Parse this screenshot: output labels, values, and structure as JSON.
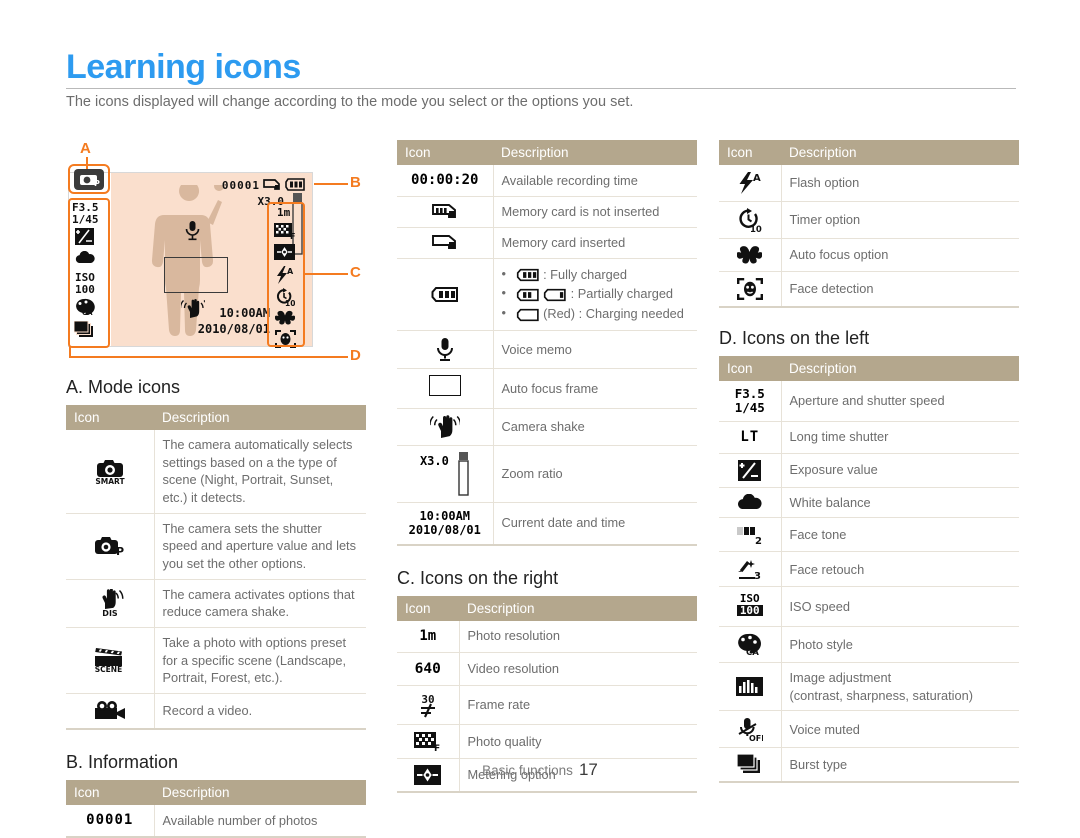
{
  "page": {
    "title": "Learning icons",
    "subtitle": "The icons displayed will change according to the mode you select or the options you set.",
    "footer_label": "Basic functions",
    "footer_page": "17",
    "accent_blue": "#2d9bf0",
    "callout_orange": "#f47b20",
    "table_header_tan": "#b4a78d",
    "lcd_background": "#fadfcd"
  },
  "lcd": {
    "callouts": [
      {
        "id": "A",
        "label": "A"
      },
      {
        "id": "B",
        "label": "B"
      },
      {
        "id": "C",
        "label": "C"
      },
      {
        "id": "D",
        "label": "D"
      }
    ],
    "top_bar": {
      "shots_remaining": "00001",
      "memory_card_icon": "memory-card-inserted-icon",
      "battery_icon": "battery-full-icon"
    },
    "zoom_ratio": "X3.0",
    "time": "10:00AM",
    "date": "2010/08/01",
    "mode_icon": "program-mode-icon",
    "left_icons": [
      {
        "name": "aperture-shutter-icon",
        "line1": "F3.5",
        "line2": "1/45"
      },
      {
        "name": "exposure-value-icon"
      },
      {
        "name": "white-balance-icon"
      },
      {
        "name": "iso-speed-icon",
        "line1": "ISO",
        "line2": "100"
      },
      {
        "name": "photo-style-icon",
        "label": "CA"
      },
      {
        "name": "burst-type-icon"
      }
    ],
    "right_icons": [
      {
        "name": "photo-resolution-icon",
        "label": "1m"
      },
      {
        "name": "photo-quality-icon",
        "label": "F"
      },
      {
        "name": "metering-option-icon"
      },
      {
        "name": "flash-option-icon",
        "label": "A"
      },
      {
        "name": "timer-option-icon",
        "label": "10"
      },
      {
        "name": "auto-focus-option-icon"
      },
      {
        "name": "face-detection-icon"
      }
    ],
    "center_icons": [
      {
        "name": "voice-memo-icon"
      },
      {
        "name": "auto-focus-frame-icon"
      },
      {
        "name": "camera-shake-icon"
      }
    ]
  },
  "tables": {
    "headers": {
      "icon": "Icon",
      "description": "Description"
    },
    "mode_icons": {
      "caption": "A. Mode icons",
      "rows": [
        {
          "icon_name": "smart-auto-mode-icon",
          "icon_text": "SMART",
          "description": "The camera automatically selects settings based on a the type of scene (Night, Portrait, Sunset, etc.) it detects."
        },
        {
          "icon_name": "program-mode-icon",
          "icon_text": "P",
          "description": "The camera sets the shutter speed and aperture value and lets you set the other options."
        },
        {
          "icon_name": "dis-mode-icon",
          "icon_text": "DIS",
          "description": "The camera activates options that reduce camera shake."
        },
        {
          "icon_name": "scene-mode-icon",
          "icon_text": "SCENE",
          "description": "Take a photo with options preset for a specific scene (Landscape, Portrait, Forest, etc.)."
        },
        {
          "icon_name": "movie-mode-icon",
          "icon_text": "",
          "description": "Record a video."
        }
      ]
    },
    "information": {
      "caption": "B. Information",
      "rows": [
        {
          "icon_name": "available-photos-icon",
          "icon_text": "00001",
          "description": "Available number of photos"
        }
      ]
    },
    "middle": {
      "rows": [
        {
          "icon_name": "recording-time-icon",
          "icon_text": "00:00:20",
          "description": "Available recording time"
        },
        {
          "icon_name": "memory-card-not-inserted-icon",
          "icon_text": "",
          "description": "Memory card is not inserted"
        },
        {
          "icon_name": "memory-card-inserted-icon",
          "icon_text": "",
          "description": "Memory card inserted"
        },
        {
          "icon_name": "battery-icon",
          "icon_text": "",
          "bullets": [
            ": Fully charged",
            ": Partially charged",
            "(Red) : Charging needed"
          ]
        },
        {
          "icon_name": "voice-memo-icon",
          "icon_text": "",
          "description": "Voice memo"
        },
        {
          "icon_name": "auto-focus-frame-icon",
          "icon_text": "",
          "description": "Auto focus frame"
        },
        {
          "icon_name": "camera-shake-icon",
          "icon_text": "",
          "description": "Camera shake"
        },
        {
          "icon_name": "zoom-ratio-icon",
          "icon_text": "X3.0",
          "description": "Zoom ratio"
        },
        {
          "icon_name": "date-time-icon",
          "icon_text": "10:00AM",
          "icon_text2": "2010/08/01",
          "description": "Current date and time"
        }
      ]
    },
    "icons_right": {
      "caption": "C. Icons on the right",
      "rows": [
        {
          "icon_name": "photo-resolution-icon",
          "icon_text": "1m",
          "description": "Photo resolution"
        },
        {
          "icon_name": "video-resolution-icon",
          "icon_text": "640",
          "description": "Video resolution"
        },
        {
          "icon_name": "frame-rate-icon",
          "icon_text": "30",
          "description": "Frame rate"
        },
        {
          "icon_name": "photo-quality-icon",
          "icon_text": "",
          "description": "Photo quality"
        },
        {
          "icon_name": "metering-option-icon",
          "icon_text": "",
          "description": "Metering option"
        }
      ]
    },
    "options": {
      "rows": [
        {
          "icon_name": "flash-option-icon",
          "icon_text": "A",
          "description": "Flash option"
        },
        {
          "icon_name": "timer-option-icon",
          "icon_text": "10",
          "description": "Timer option"
        },
        {
          "icon_name": "auto-focus-option-icon",
          "icon_text": "",
          "description": "Auto focus option"
        },
        {
          "icon_name": "face-detection-icon",
          "icon_text": "",
          "description": "Face detection"
        }
      ]
    },
    "icons_left": {
      "caption": "D. Icons on the left",
      "rows": [
        {
          "icon_name": "aperture-shutter-icon",
          "icon_text": "F3.5",
          "icon_text2": "1/45",
          "description": "Aperture and shutter speed"
        },
        {
          "icon_name": "long-time-shutter-icon",
          "icon_text": "LT",
          "description": "Long time shutter"
        },
        {
          "icon_name": "exposure-value-icon",
          "icon_text": "",
          "description": "Exposure value"
        },
        {
          "icon_name": "white-balance-icon",
          "icon_text": "",
          "description": "White balance"
        },
        {
          "icon_name": "face-tone-icon",
          "icon_text": "2",
          "description": "Face tone"
        },
        {
          "icon_name": "face-retouch-icon",
          "icon_text": "3",
          "description": "Face retouch"
        },
        {
          "icon_name": "iso-speed-icon",
          "icon_text": "ISO",
          "icon_text2": "100",
          "description": "ISO speed"
        },
        {
          "icon_name": "photo-style-icon",
          "icon_text": "CA",
          "description": "Photo style"
        },
        {
          "icon_name": "image-adjustment-icon",
          "icon_text": "",
          "description": "Image adjustment\n(contrast, sharpness, saturation)"
        },
        {
          "icon_name": "voice-muted-icon",
          "icon_text": "OFF",
          "description": "Voice muted"
        },
        {
          "icon_name": "burst-type-icon",
          "icon_text": "",
          "description": "Burst type"
        }
      ]
    }
  }
}
